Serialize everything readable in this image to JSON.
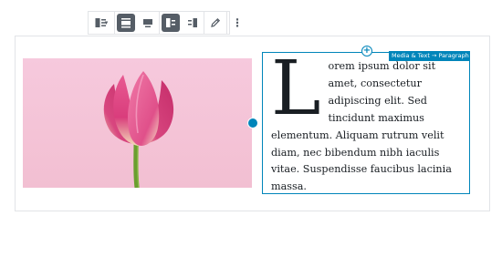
{
  "toolbar": {
    "buttons": [
      {
        "icon": "media-text-block-icon",
        "has_dropdown": true,
        "active": false
      },
      {
        "icon": "align-wide-icon",
        "active": true
      },
      {
        "icon": "align-full-icon",
        "active": false
      },
      {
        "icon": "media-left-icon",
        "active": true
      },
      {
        "icon": "media-right-icon",
        "active": false
      },
      {
        "icon": "pencil-edit-icon",
        "active": false
      },
      {
        "icon": "more-options-icon",
        "active": false
      }
    ],
    "dropdown_caret": "▾",
    "more_glyph": "⋮"
  },
  "media": {
    "image": "pink tulip on pink background"
  },
  "content": {
    "breadcrumb": "Media & Text → Paragraph",
    "inserter_glyph": "+",
    "dropcap": "L",
    "paragraph": "orem ipsum dolor sit amet, consectetur adipiscing elit. Sed tincidunt maximus elementum. Aliquam rutrum velit diam, nec bibendum nibh iaculis vitae. Suspendisse faucibus lacinia massa."
  },
  "colors": {
    "accent": "#0085ba",
    "text": "#191e23",
    "toolbar_active": "#555d66",
    "border": "#e2e4e7"
  }
}
